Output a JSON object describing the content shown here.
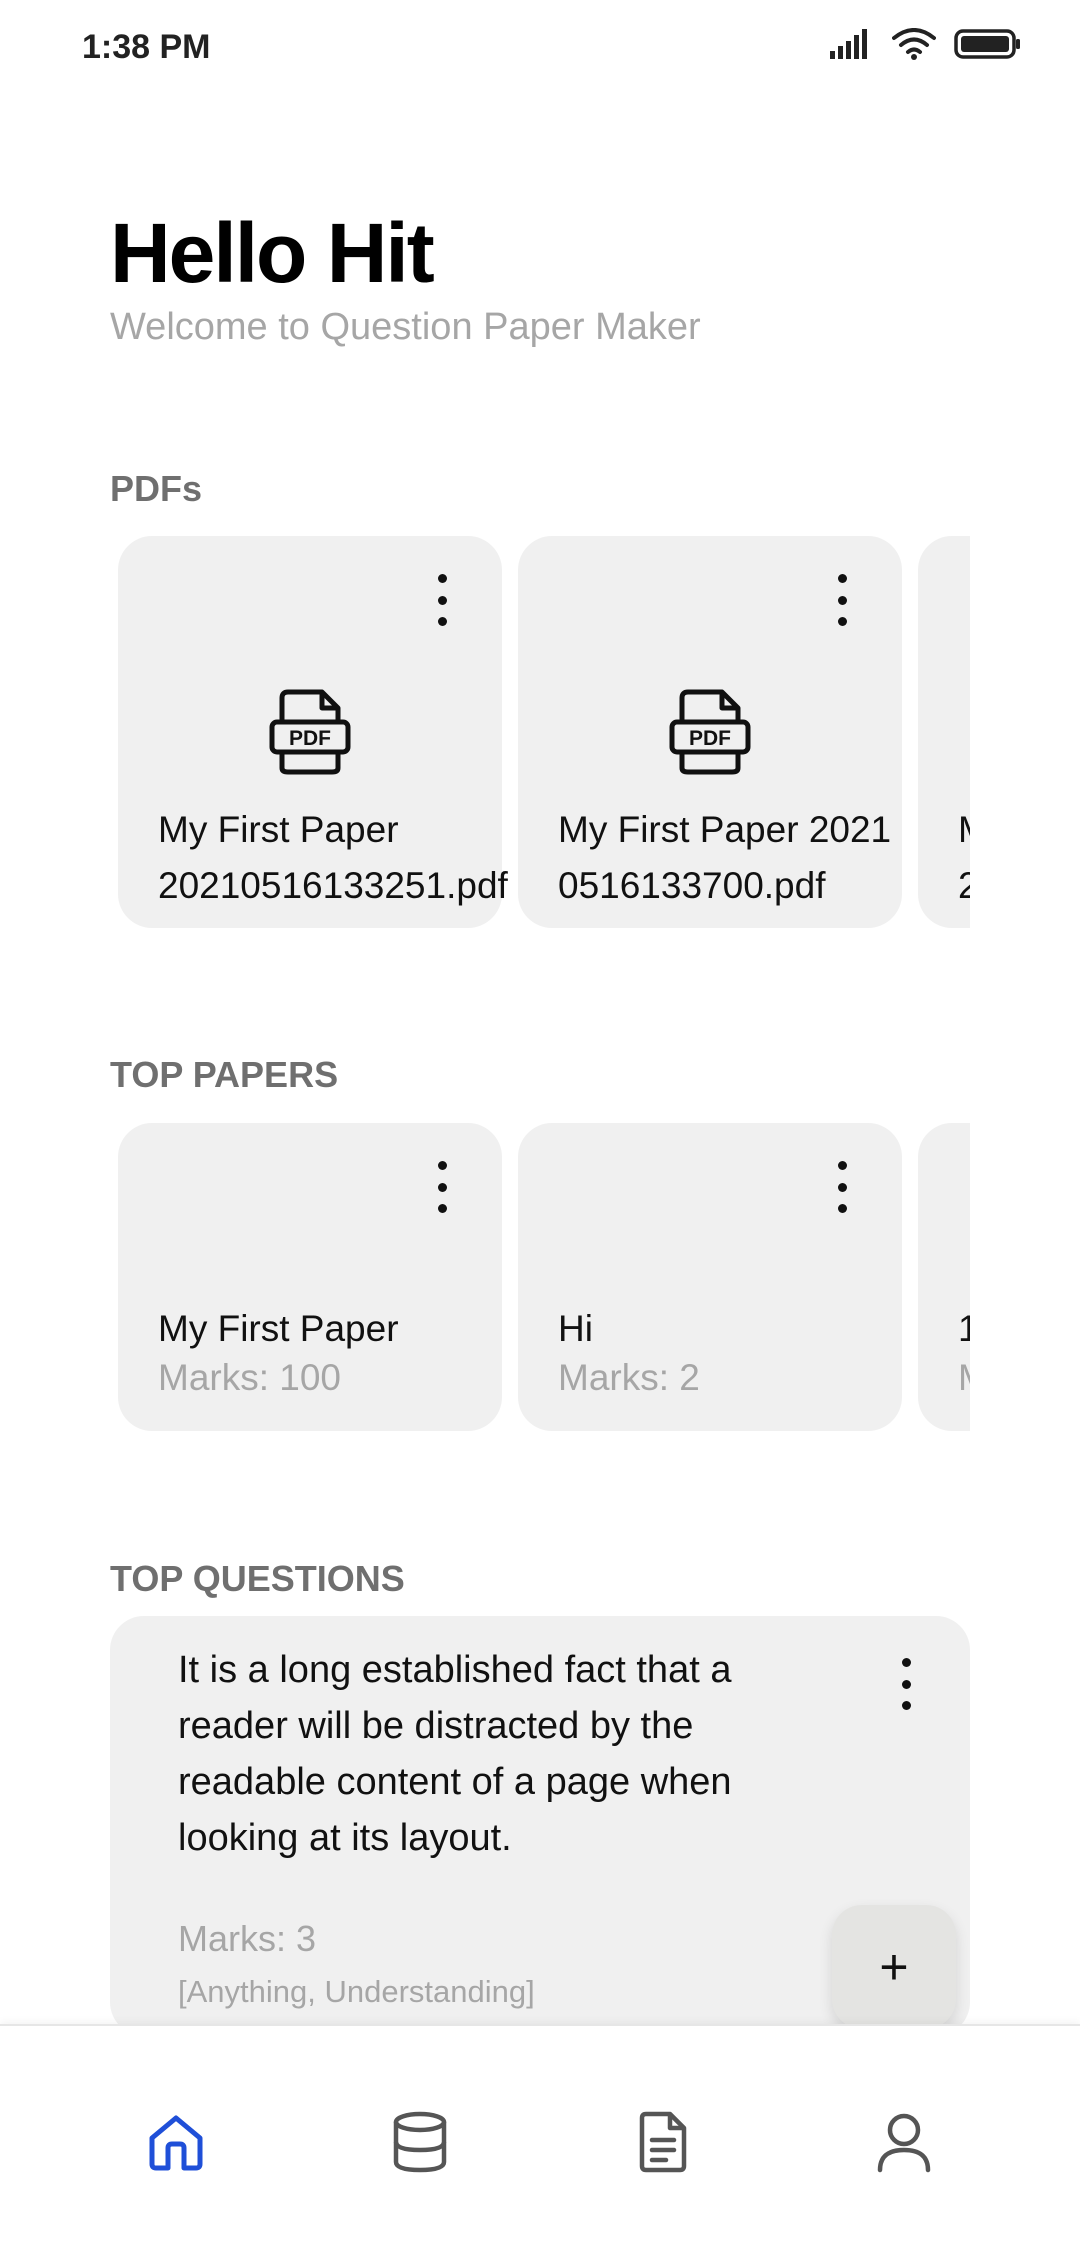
{
  "status_bar": {
    "time": "1:38 PM",
    "icons": [
      "signal-icon",
      "wifi-icon",
      "battery-icon"
    ]
  },
  "header": {
    "greeting": "Hello Hit",
    "subtitle": "Welcome to Question Paper Maker"
  },
  "pdfs": {
    "title": "PDFs",
    "items": [
      {
        "name": "My First Paper\n20210516133251.pdf",
        "icon": "pdf-file-icon"
      },
      {
        "name": "My First Paper 2021\n0516133700.pdf",
        "icon": "pdf-file-icon"
      },
      {
        "name": "M\n2",
        "icon": "pdf-file-icon"
      }
    ]
  },
  "top_papers": {
    "title": "TOP PAPERS",
    "items": [
      {
        "name": "My First Paper",
        "marks": "Marks: 100"
      },
      {
        "name": "Hi",
        "marks": "Marks: 2"
      },
      {
        "name": "1",
        "marks": "M"
      }
    ]
  },
  "top_questions": {
    "title": "TOP QUESTIONS",
    "items": [
      {
        "text": "It is a long established fact that a reader will be distracted by the readable content of a page when looking at its layout.",
        "marks": "Marks: 3",
        "tags": "[Anything, Understanding]"
      }
    ]
  },
  "fab": {
    "label": "+"
  },
  "bottom_nav": {
    "active_color": "#1f4fd8",
    "inactive_color": "#555555",
    "items": [
      "home-icon",
      "database-icon",
      "document-icon",
      "profile-icon"
    ],
    "active": "home-icon"
  }
}
